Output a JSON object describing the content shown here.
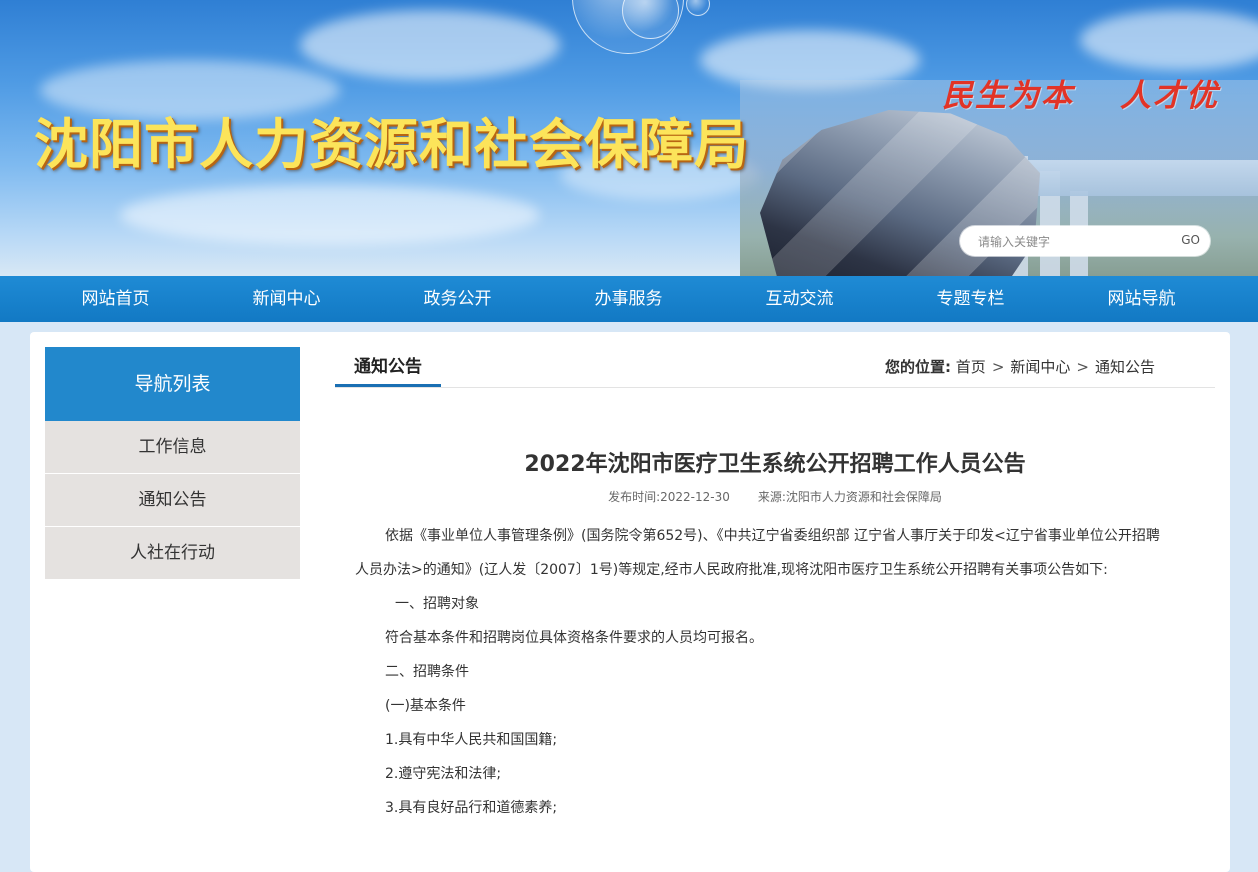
{
  "banner": {
    "site_title": "沈阳市人力资源和社会保障局",
    "slogan_left": "民生为本",
    "slogan_right": "人才优",
    "search_placeholder": "请输入关键字",
    "search_button": "GO"
  },
  "colors": {
    "nav_blue": "#1279c4",
    "sidebar_head": "#2288cc",
    "title_yellow": "#fce45a",
    "slogan_red": "#e23326"
  },
  "nav": {
    "items": [
      "网站首页",
      "新闻中心",
      "政务公开",
      "办事服务",
      "互动交流",
      "专题专栏",
      "网站导航"
    ]
  },
  "sidebar": {
    "title": "导航列表",
    "items": [
      "工作信息",
      "通知公告",
      "人社在行动"
    ]
  },
  "section": {
    "title": "通知公告",
    "breadcrumb_label": "您的位置:",
    "breadcrumb": [
      "首页",
      "新闻中心",
      "通知公告"
    ],
    "breadcrumb_sep": ">"
  },
  "article": {
    "title": "2022年沈阳市医疗卫生系统公开招聘工作人员公告",
    "publish_time": "发布时间:2022-12-30",
    "source": "来源:沈阳市人力资源和社会保障局",
    "lead": "依据《事业单位人事管理条例》(国务院令第652号)、《中共辽宁省委组织部 辽宁省人事厅关于印发<辽宁省事业单位公开招聘人员办法>的通知》(辽人发〔2007〕1号)等规定,经市人民政府批准,现将沈阳市医疗卫生系统公开招聘有关事项公告如下:",
    "paragraphs": [
      "一、招聘对象",
      "符合基本条件和招聘岗位具体资格条件要求的人员均可报名。",
      "二、招聘条件",
      "(一)基本条件",
      "1.具有中华人民共和国国籍;",
      "2.遵守宪法和法律;",
      "3.具有良好品行和道德素养;"
    ]
  }
}
